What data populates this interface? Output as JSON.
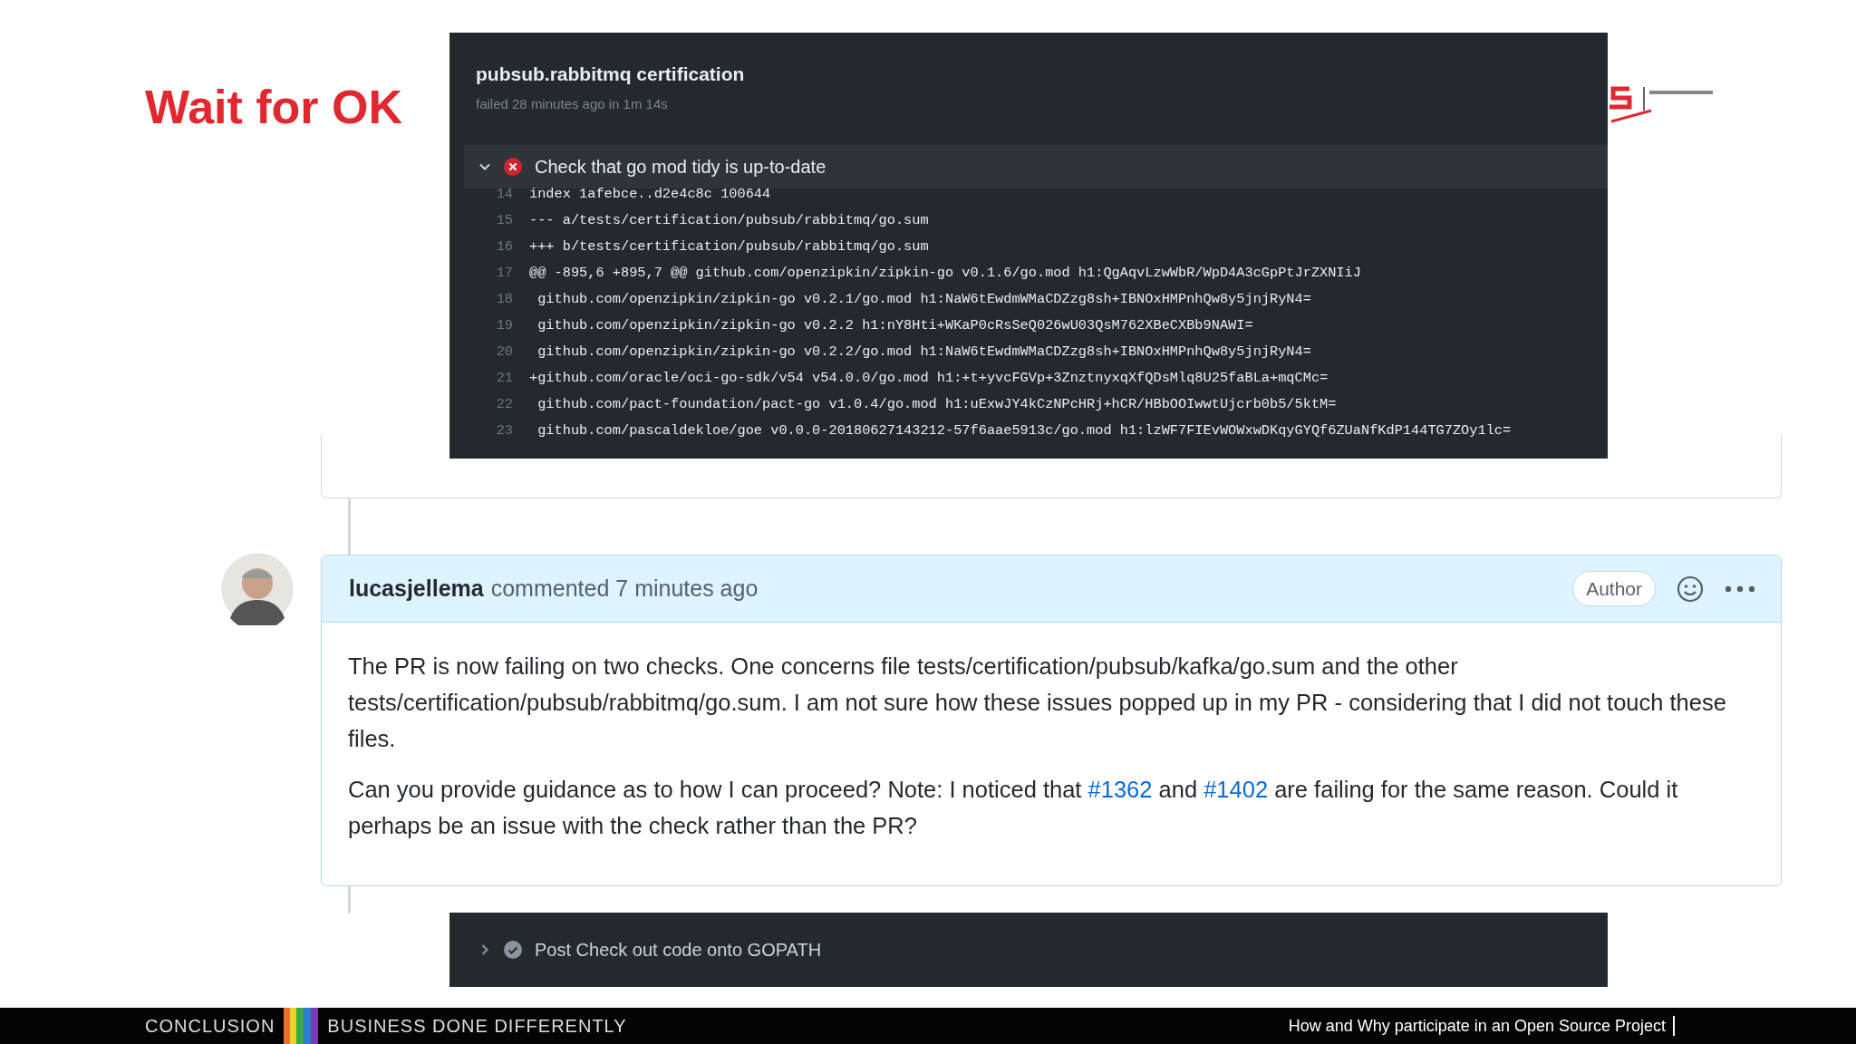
{
  "slide_title": "Wait for OK",
  "job_panel": {
    "title": "pubsub.rabbitmq certification",
    "subtitle": "failed 28 minutes ago in 1m 14s",
    "step": {
      "label": "Check that go mod tidy is up-to-date",
      "expanded": true,
      "failed": true
    },
    "log_lines": [
      {
        "number": "14",
        "text": "index 1afebce..d2e4c8c 100644"
      },
      {
        "number": "15",
        "text": "--- a/tests/certification/pubsub/rabbitmq/go.sum"
      },
      {
        "number": "16",
        "text": "+++ b/tests/certification/pubsub/rabbitmq/go.sum"
      },
      {
        "number": "17",
        "text": "@@ -895,6 +895,7 @@ github.com/openzipkin/zipkin-go v0.1.6/go.mod h1:QgAqvLzwWbR/WpD4A3cGpPtJrZXNIiJ"
      },
      {
        "number": "18",
        "text": " github.com/openzipkin/zipkin-go v0.2.1/go.mod h1:NaW6tEwdmWMaCDZzg8sh+IBNOxHMPnhQw8y5jnjRyN4="
      },
      {
        "number": "19",
        "text": " github.com/openzipkin/zipkin-go v0.2.2 h1:nY8Hti+WKaP0cRsSeQ026wU03QsM762XBeCXBb9NAWI="
      },
      {
        "number": "20",
        "text": " github.com/openzipkin/zipkin-go v0.2.2/go.mod h1:NaW6tEwdmWMaCDZzg8sh+IBNOxHMPnhQw8y5jnjRyN4="
      },
      {
        "number": "21",
        "text": "+github.com/oracle/oci-go-sdk/v54 v54.0.0/go.mod h1:+t+yvcFGVp+3ZnztnyxqXfQDsMlq8U25faBLa+mqCMc="
      },
      {
        "number": "22",
        "text": " github.com/pact-foundation/pact-go v1.0.4/go.mod h1:uExwJY4kCzNPcHRj+hCR/HBbOOIwwtUjcrb0b5/5ktM="
      },
      {
        "number": "23",
        "text": " github.com/pascaldekloe/goe v0.0.0-20180627143212-57f6aae5913c/go.mod h1:lzWF7FIEvWOWxwDKqyGYQf6ZUaNfKdP144TG7ZOy1lc="
      }
    ]
  },
  "comment": {
    "author": "lucasjellema",
    "meta": "commented 7 minutes ago",
    "badge": "Author",
    "paragraphs": [
      [
        {
          "kind": "text",
          "text": "The PR is now failing on two checks. One concerns file tests/certification/pubsub/kafka/go.sum and the other tests/certification/pubsub/rabbitmq/go.sum. I am not sure how these issues popped up in my PR - considering that I did not touch these files."
        }
      ],
      [
        {
          "kind": "text",
          "text": "Can you provide guidance as to how I can proceed? Note: I noticed that "
        },
        {
          "kind": "link",
          "text": "#1362"
        },
        {
          "kind": "text",
          "text": " and "
        },
        {
          "kind": "link",
          "text": "#1402"
        },
        {
          "kind": "text",
          "text": " are failing for the same reason. Could it perhaps be an issue with the check rather than the PR?"
        }
      ]
    ]
  },
  "step_panel": {
    "label": "Post Check out code onto GOPATH",
    "expanded": false,
    "failed": false
  },
  "footer": {
    "section": "CONCLUSION",
    "tagline": "BUSINESS DONE DIFFERENTLY",
    "talk_title": "How and Why participate in an Open Source Project"
  }
}
